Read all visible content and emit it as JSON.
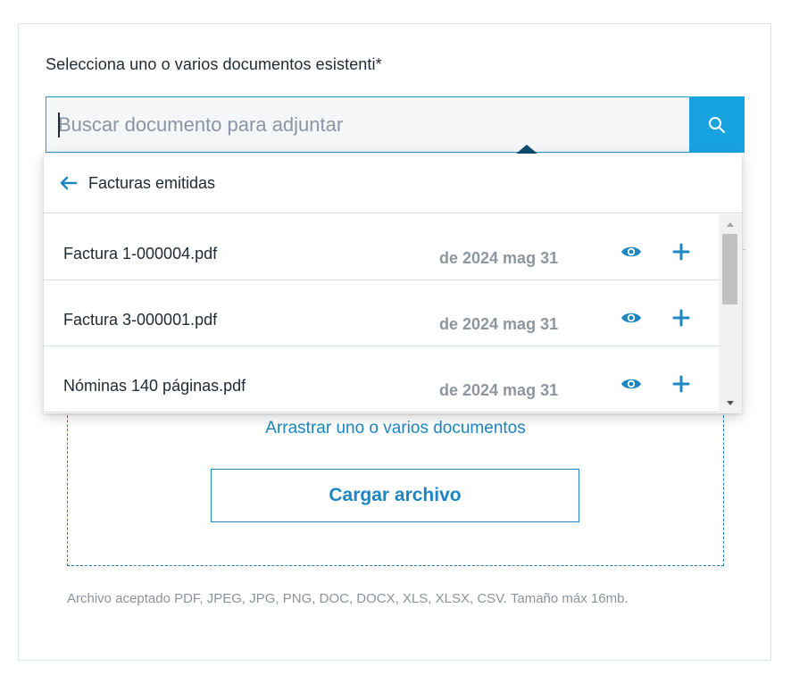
{
  "form": {
    "label": "Selecciona uno o varios documentos esistenti*",
    "search": {
      "value": "",
      "placeholder": "Buscar documento para adjuntar",
      "button_icon": "search-icon"
    }
  },
  "dropdown": {
    "header": {
      "back_icon": "arrow-left-icon",
      "title": "Facturas emitidas"
    },
    "items": [
      {
        "name": "Factura 1-000004.pdf",
        "date": "de 2024 mag 31"
      },
      {
        "name": "Factura 3-000001.pdf",
        "date": "de 2024 mag 31"
      },
      {
        "name": "Nóminas 140 páginas.pdf",
        "date": "de 2024 mag 31"
      }
    ]
  },
  "dropzone": {
    "drag_text": "Arrastrar uno o varios documentos",
    "upload_label": "Cargar archivo"
  },
  "help": {
    "text": "Archivo aceptado PDF, JPEG, JPG, PNG, DOC, DOCX, XLS, XLSX, CSV. Tamaño máx 16mb."
  },
  "colors": {
    "accent": "#17a3e0",
    "link": "#1c86c2",
    "text": "#1f2933",
    "muted": "#8d969e"
  }
}
